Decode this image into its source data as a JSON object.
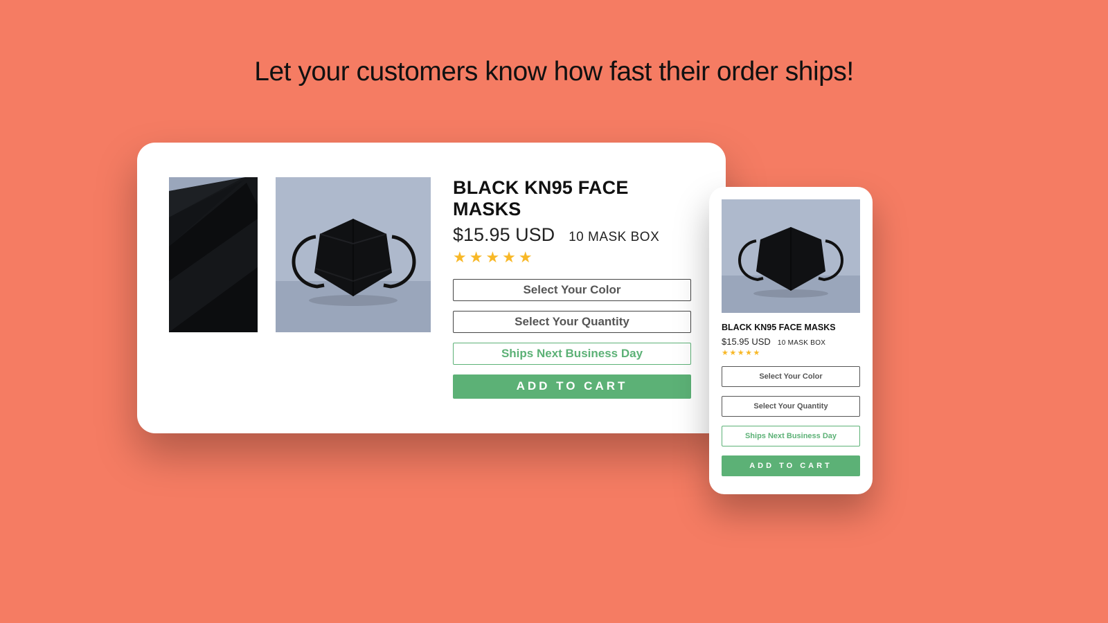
{
  "headline": "Let your customers know how fast their order ships!",
  "product": {
    "title": "BLACK KN95 FACE MASKS",
    "price": "$15.95 USD",
    "variant": "10 MASK BOX",
    "rating_stars": "★★★★★"
  },
  "controls": {
    "select_color": "Select Your Color",
    "select_quantity": "Select Your Quantity",
    "shipping_notice": "Ships Next Business Day",
    "add_to_cart": "ADD TO CART"
  },
  "colors": {
    "accent_green": "#5cb176",
    "background": "#f57c63",
    "star": "#f8b827"
  }
}
